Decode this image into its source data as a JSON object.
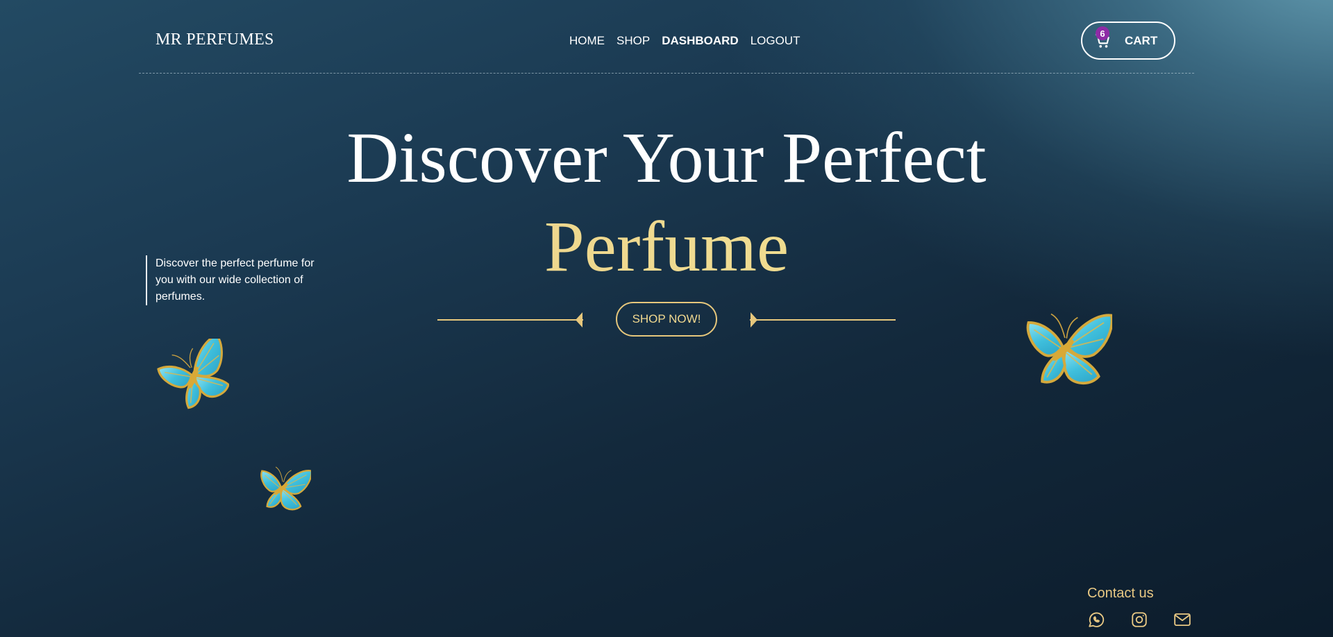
{
  "brand": {
    "name": "MR PERFUMES"
  },
  "nav": {
    "items": [
      "HOME",
      "SHOP",
      "DASHBOARD",
      "LOGOUT"
    ],
    "active": "DASHBOARD"
  },
  "cart": {
    "label": "CART",
    "count": "6",
    "icon": "cart-icon"
  },
  "hero": {
    "title_line1": "Discover Your Perfect",
    "title_line2": "Perfume",
    "description": "Discover the perfect perfume for you with our wide collection of perfumes.",
    "cta_label": "SHOP NOW!"
  },
  "contact": {
    "title": "Contact us",
    "icons": [
      "whatsapp-icon",
      "instagram-icon",
      "mail-icon"
    ]
  },
  "colors": {
    "accent_gold": "#e6c77c",
    "badge_purple": "#8e2ba6",
    "background_dark": "#0c1c2b",
    "butterfly_cyan": "#4fc4de"
  }
}
